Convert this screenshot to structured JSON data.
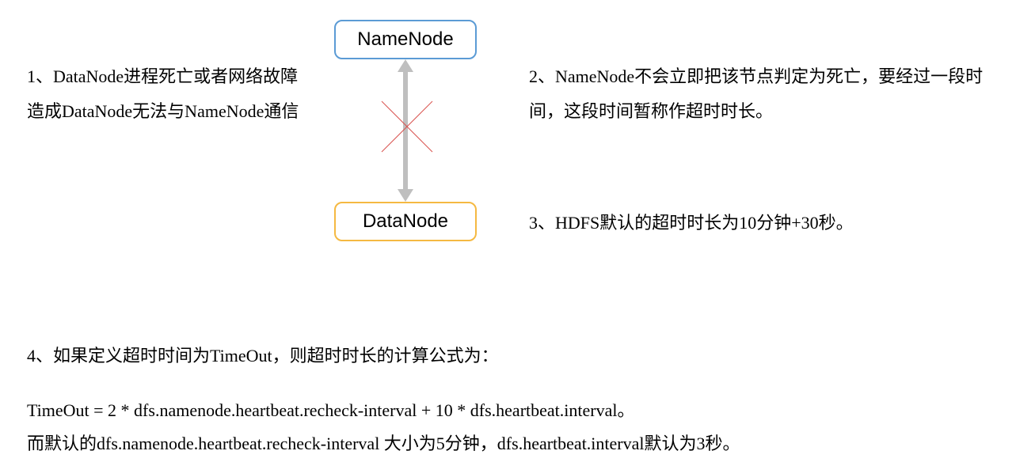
{
  "nodes": {
    "namenode": "NameNode",
    "datanode": "DataNode"
  },
  "texts": {
    "point1": "1、DataNode进程死亡或者网络故障造成DataNode无法与NameNode通信",
    "point2": "2、NameNode不会立即把该节点判定为死亡，要经过一段时间，这段时间暂称作超时时长。",
    "point3": "3、HDFS默认的超时时长为10分钟+30秒。",
    "point4": "4、如果定义超时时间为TimeOut，则超时时长的计算公式为：",
    "formula_line1": "TimeOut  = 2 * dfs.namenode.heartbeat.recheck-interval + 10 * dfs.heartbeat.interval。",
    "formula_line2": "而默认的dfs.namenode.heartbeat.recheck-interval 大小为5分钟，dfs.heartbeat.interval默认为3秒。"
  },
  "chart_data": {
    "type": "diagram",
    "title": "DataNode timeout mechanism",
    "nodes": [
      {
        "id": "NameNode",
        "label": "NameNode"
      },
      {
        "id": "DataNode",
        "label": "DataNode"
      }
    ],
    "edges": [
      {
        "from": "NameNode",
        "to": "DataNode",
        "bidirectional": true,
        "broken": true
      }
    ],
    "annotations": {
      "default_timeout": "10分钟+30秒",
      "formula": "TimeOut = 2 * dfs.namenode.heartbeat.recheck-interval + 10 * dfs.heartbeat.interval",
      "recheck_interval_default": "5分钟",
      "heartbeat_interval_default": "3秒"
    }
  }
}
